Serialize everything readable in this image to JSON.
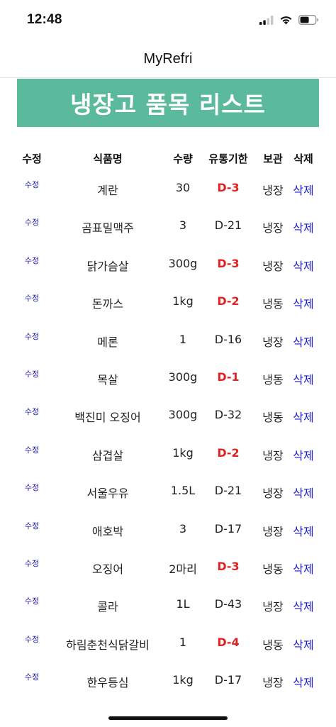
{
  "status_bar": {
    "time": "12:48",
    "icons": [
      "cellular-signal-icon",
      "wifi-icon",
      "battery-icon"
    ]
  },
  "nav": {
    "title": "MyRefri"
  },
  "banner": {
    "title": "냉장고 품목 리스트",
    "color": "#5bba9c"
  },
  "table": {
    "headers": {
      "edit": "수정",
      "name": "식품명",
      "qty": "수량",
      "expiry": "유통기한",
      "storage": "보관",
      "delete": "삭제"
    },
    "rows": [
      {
        "edit": "수정",
        "name": "계란",
        "qty": "30",
        "expiry": "D-3",
        "urgent": true,
        "storage": "냉장",
        "delete": "삭제"
      },
      {
        "edit": "수정",
        "name": "곰표밀맥주",
        "qty": "3",
        "expiry": "D-21",
        "urgent": false,
        "storage": "냉장",
        "delete": "삭제"
      },
      {
        "edit": "수정",
        "name": "닭가슴살",
        "qty": "300g",
        "expiry": "D-3",
        "urgent": true,
        "storage": "냉장",
        "delete": "삭제"
      },
      {
        "edit": "수정",
        "name": "돈까스",
        "qty": "1kg",
        "expiry": "D-2",
        "urgent": true,
        "storage": "냉동",
        "delete": "삭제"
      },
      {
        "edit": "수정",
        "name": "메론",
        "qty": "1",
        "expiry": "D-16",
        "urgent": false,
        "storage": "냉장",
        "delete": "삭제"
      },
      {
        "edit": "수정",
        "name": "목살",
        "qty": "300g",
        "expiry": "D-1",
        "urgent": true,
        "storage": "냉동",
        "delete": "삭제"
      },
      {
        "edit": "수정",
        "name": "백진미 오징어",
        "qty": "300g",
        "expiry": "D-32",
        "urgent": false,
        "storage": "냉동",
        "delete": "삭제"
      },
      {
        "edit": "수정",
        "name": "삼겹살",
        "qty": "1kg",
        "expiry": "D-2",
        "urgent": true,
        "storage": "냉장",
        "delete": "삭제"
      },
      {
        "edit": "수정",
        "name": "서울우유",
        "qty": "1.5L",
        "expiry": "D-21",
        "urgent": false,
        "storage": "냉장",
        "delete": "삭제"
      },
      {
        "edit": "수정",
        "name": "애호박",
        "qty": "3",
        "expiry": "D-17",
        "urgent": false,
        "storage": "냉장",
        "delete": "삭제"
      },
      {
        "edit": "수정",
        "name": "오징어",
        "qty": "2마리",
        "expiry": "D-3",
        "urgent": true,
        "storage": "냉동",
        "delete": "삭제"
      },
      {
        "edit": "수정",
        "name": "콜라",
        "qty": "1L",
        "expiry": "D-43",
        "urgent": false,
        "storage": "냉장",
        "delete": "삭제"
      },
      {
        "edit": "수정",
        "name": "하림춘천식닭갈비",
        "qty": "1",
        "expiry": "D-4",
        "urgent": true,
        "storage": "냉동",
        "delete": "삭제"
      },
      {
        "edit": "수정",
        "name": "한우등심",
        "qty": "1kg",
        "expiry": "D-17",
        "urgent": false,
        "storage": "냉장",
        "delete": "삭제"
      }
    ]
  },
  "colors": {
    "urgent": "#e32121",
    "link": "#1a1acc"
  }
}
